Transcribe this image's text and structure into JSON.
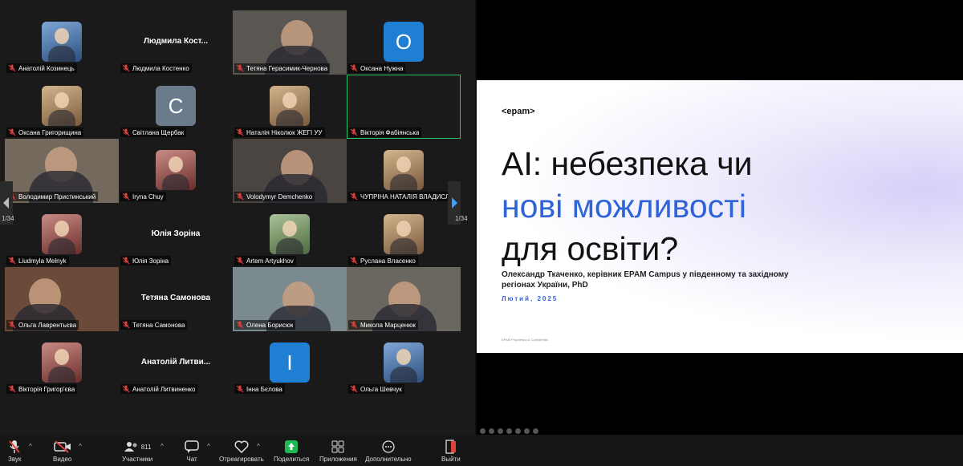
{
  "participants": [
    {
      "name": "Анатолій Козинець",
      "kind": "photo",
      "tone": "blue"
    },
    {
      "name": "Людмила Костенко",
      "kind": "name",
      "big": "Людмила Кост..."
    },
    {
      "name": "Тетяна Герасимик-Чернова",
      "kind": "video"
    },
    {
      "name": "Оксана Нужна",
      "kind": "letter",
      "letter": "О",
      "color": "#1f7fd3"
    },
    {
      "name": "Оксана Григорищина",
      "kind": "photo",
      "tone": "warm"
    },
    {
      "name": "Світлана Щербак",
      "kind": "letter",
      "letter": "С",
      "color": "#6b7b8c"
    },
    {
      "name": "Наталія Ніколюк  ЖЕГІ УУ",
      "kind": "photo",
      "tone": "warm"
    },
    {
      "name": "Вікторія Фабіянська",
      "kind": "name",
      "big": "",
      "active": true
    },
    {
      "name": "Володимир Пристинський",
      "kind": "video"
    },
    {
      "name": "Iryna Chuy",
      "kind": "photo",
      "tone": "red"
    },
    {
      "name": "Volodymyr Demchenko",
      "kind": "video"
    },
    {
      "name": "ЧУПРІНА НАТАЛІЯ ВЛАДИСЛ...",
      "kind": "photo",
      "tone": "warm"
    },
    {
      "name": "Liudmyla Melnyk",
      "kind": "photo",
      "tone": "red"
    },
    {
      "name": "Юлія Зоріна",
      "kind": "name",
      "big": "Юлія Зоріна"
    },
    {
      "name": "Artem Artyukhov",
      "kind": "photo",
      "tone": "green"
    },
    {
      "name": "Руслана Власенко",
      "kind": "photo",
      "tone": "warm"
    },
    {
      "name": "Ольга Лаврентьєва",
      "kind": "video"
    },
    {
      "name": "Тетяна Самонова",
      "kind": "name",
      "big": "Тетяна Самонова"
    },
    {
      "name": "Олена Борисюк",
      "kind": "video"
    },
    {
      "name": "Микола Марценюк",
      "kind": "video"
    },
    {
      "name": "Вікторія Григор'єва",
      "kind": "photo",
      "tone": "red"
    },
    {
      "name": "Анатолій Литвиненко",
      "kind": "name",
      "big": "Анатолій Литви..."
    },
    {
      "name": "Інна Бєлова",
      "kind": "letter",
      "letter": "І",
      "color": "#1f7fd3"
    },
    {
      "name": "Ольга Шевчук",
      "kind": "photo",
      "tone": "blue"
    }
  ],
  "pagination": {
    "left": "1/34",
    "right": "1/34"
  },
  "slide": {
    "logo": "<epam>",
    "title_line1": "AI: небезпека чи",
    "title_line2": "нові можливості",
    "title_line3": "для освіти?",
    "subtitle": "Олександр Ткаченко, керівник EPAM Campus у південному та західному регіонах України, PhD",
    "date": "Лютий, 2025",
    "footer": "EPAM Proprietary & Confidential"
  },
  "toolbar": {
    "audio": "Звук",
    "video": "Видео",
    "participants": "Участники",
    "participants_count": "811",
    "chat": "Чат",
    "react": "Отреагировать",
    "share": "Поделиться",
    "apps": "Приложения",
    "more": "Дополнительно",
    "leave": "Выйти"
  },
  "colors": {
    "active_border": "#29c46a",
    "mute_red": "#e0403a",
    "share_green": "#1db954",
    "accent_blue": "#2f63d8"
  }
}
